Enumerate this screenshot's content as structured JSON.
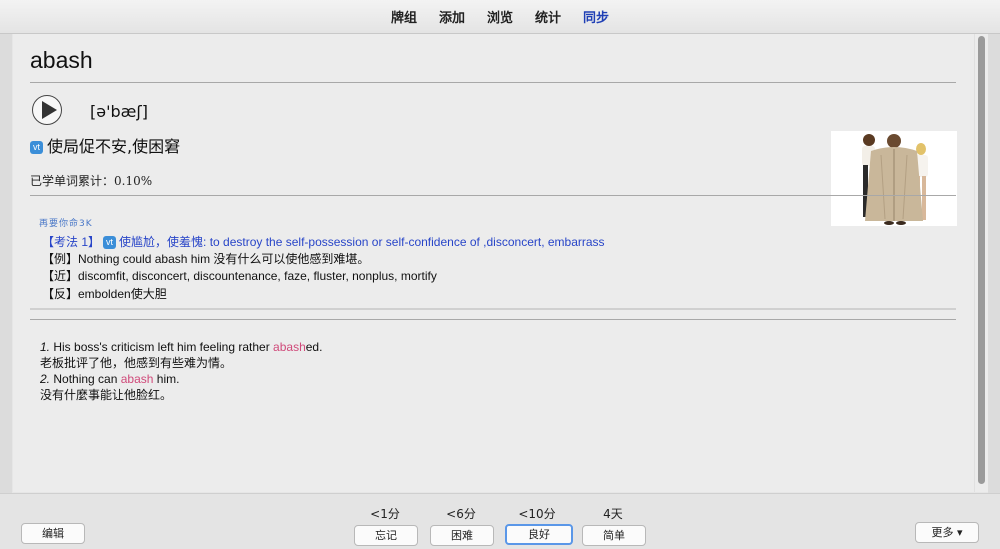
{
  "toolbar": {
    "items": [
      "牌组",
      "添加",
      "浏览",
      "统计",
      "同步"
    ]
  },
  "card": {
    "word": "abash",
    "phonetic": "[ə'bæʃ]",
    "pos": "vt",
    "definition": "使局促不安,使困窘",
    "stats": "已学单词累计：0.10%",
    "exam": {
      "tag": "再要你命3K",
      "line1_prefix": "【考法 1】",
      "line1_pos": "vt",
      "line1_text": "使尴尬，使羞愧: to destroy the self-possession or self-confidence of ,disconcert, embarrass",
      "line2": "【例】Nothing could abash him 没有什么可以使他感到难堪。",
      "line3": "【近】discomfit, disconcert, discountenance, faze, fluster, nonplus, mortify",
      "line4": "【反】embolden使大胆"
    },
    "examples": [
      {
        "num": "1.",
        "before": " His boss's criticism left him feeling rather ",
        "highlight": "abash",
        "after": "ed."
      },
      {
        "translation": "老板批评了他，他感到有些难为情。"
      },
      {
        "num": "2.",
        "before": " Nothing can ",
        "highlight": "abash",
        "after": " him."
      },
      {
        "translation": "没有什麼事能让他脸红。"
      }
    ]
  },
  "bottom": {
    "edit_label": "编辑",
    "more_label": "更多 ▾",
    "answers": [
      {
        "interval": "<1分",
        "label": "忘记"
      },
      {
        "interval": "<6分",
        "label": "困难"
      },
      {
        "interval": "<10分",
        "label": "良好"
      },
      {
        "interval": "4天",
        "label": "简单"
      }
    ]
  },
  "colors": {
    "active_tab": "#1f3fb5",
    "exam_line": "#2845c8",
    "highlight": "#d04a7a",
    "badge": "#3b8ed8",
    "focus_ring": "#5a97e8"
  },
  "icons": {
    "play": "play-icon",
    "dropdown": "chevron-down-icon"
  }
}
